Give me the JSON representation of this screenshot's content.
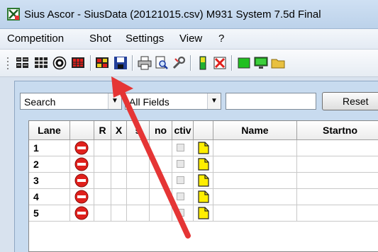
{
  "window": {
    "title": "Sius Ascor - SiusData  (20121015.csv)  M931 System 7.5d Final"
  },
  "menu": [
    "Competition",
    "Shot",
    "Settings",
    "View",
    "?"
  ],
  "toolbar": {
    "icons": [
      "grid-small-icon",
      "grid-large-icon",
      "target-icon",
      "grid-color-icon",
      "grid-red-icon",
      "save-icon",
      "print-icon",
      "print-preview-icon",
      "tools-icon",
      "battery-icon",
      "cancel-icon",
      "green-square-icon",
      "monitor-icon",
      "folder-icon"
    ]
  },
  "filter": {
    "search_label": "Search",
    "fields_label": "All Fields",
    "query_value": "",
    "reset_label": "Reset"
  },
  "grid": {
    "columns": [
      "Lane",
      "",
      "R",
      "X",
      "s",
      "no",
      "ctiv",
      "",
      "Name",
      "Startno"
    ],
    "rows": [
      {
        "lane": "1"
      },
      {
        "lane": "2"
      },
      {
        "lane": "3"
      },
      {
        "lane": "4"
      },
      {
        "lane": "5"
      }
    ]
  },
  "colors": {
    "stop": "#e0201c",
    "arrow": "#e53535",
    "note": "#ffee00"
  }
}
